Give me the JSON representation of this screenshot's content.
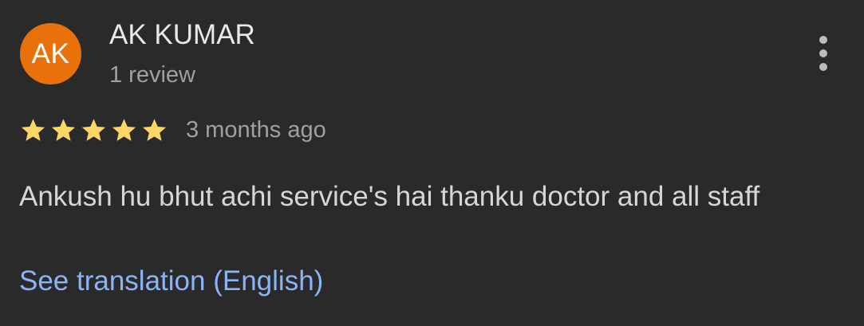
{
  "review": {
    "author_initials": "AK",
    "author_name": "AK KUMAR",
    "review_count": "1 review",
    "rating": 5,
    "rating_max": 5,
    "date": "3 months ago",
    "text": "Ankush hu bhut achi service's hai thanku doctor and all staff",
    "translate_label": "See translation (English)"
  },
  "icons": {
    "more": "more-vertical-icon",
    "star": "star-icon"
  },
  "colors": {
    "background": "#2a2a2a",
    "avatar": "#e8710a",
    "star": "#fdd663",
    "link": "#8ab4f8"
  }
}
